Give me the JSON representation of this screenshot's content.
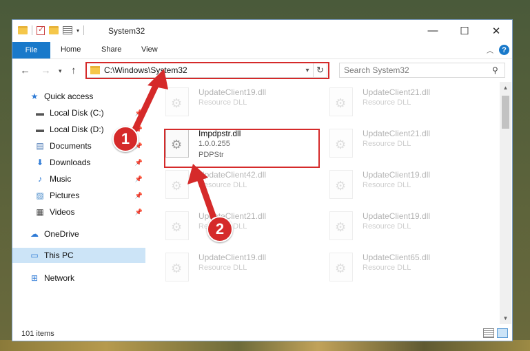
{
  "window": {
    "title": "System32",
    "controls": [
      "—",
      "☐",
      "✕"
    ]
  },
  "ribbon": {
    "file_tab": "File",
    "tabs": [
      "Home",
      "Share",
      "View"
    ],
    "help_label": "?"
  },
  "nav": {
    "address_path": "C:\\Windows\\System32",
    "search_placeholder": "Search System32"
  },
  "sidebar": {
    "items": [
      {
        "label": "Quick access",
        "icon": "star-icon",
        "pinned": false
      },
      {
        "label": "Local Disk (C:)",
        "icon": "drive-icon",
        "pinned": true
      },
      {
        "label": "Local Disk (D:)",
        "icon": "drive-icon",
        "pinned": true
      },
      {
        "label": "Documents",
        "icon": "documents-icon",
        "pinned": true
      },
      {
        "label": "Downloads",
        "icon": "download-icon",
        "pinned": true
      },
      {
        "label": "Music",
        "icon": "music-icon",
        "pinned": true
      },
      {
        "label": "Pictures",
        "icon": "pictures-icon",
        "pinned": true
      },
      {
        "label": "Videos",
        "icon": "videos-icon",
        "pinned": true
      },
      {
        "label": "OneDrive",
        "icon": "cloud-icon",
        "pinned": false
      },
      {
        "label": "This PC",
        "icon": "computer-icon",
        "pinned": false,
        "selected": true
      },
      {
        "label": "Network",
        "icon": "network-icon",
        "pinned": false
      }
    ]
  },
  "files": [
    {
      "name": "UpdateClient19.dll",
      "line2": "Resource DLL",
      "line3": ""
    },
    {
      "name": "UpdateClient21.dll",
      "line2": "Resource DLL",
      "line3": ""
    },
    {
      "name": "Impdpstr.dll",
      "line2": "1.0.0.255",
      "line3": "PDPStr"
    },
    {
      "name": "UpdateClient21.dll",
      "line2": "Resource DLL",
      "line3": ""
    },
    {
      "name": "UpdateClient42.dll",
      "line2": "Resource DLL",
      "line3": ""
    },
    {
      "name": "UpdateClient19.dll",
      "line2": "Resource DLL",
      "line3": ""
    },
    {
      "name": "UpdateClient21.dll",
      "line2": "Resource DLL",
      "line3": ""
    },
    {
      "name": "UpdateClient19.dll",
      "line2": "Resource DLL",
      "line3": ""
    },
    {
      "name": "UpdateClient19.dll",
      "line2": "Resource DLL",
      "line3": ""
    },
    {
      "name": "UpdateClient65.dll",
      "line2": "Resource DLL",
      "line3": ""
    }
  ],
  "status": {
    "item_count": "101 items"
  },
  "annotations": {
    "step1": "1",
    "step2": "2",
    "color": "#d52a2a"
  }
}
